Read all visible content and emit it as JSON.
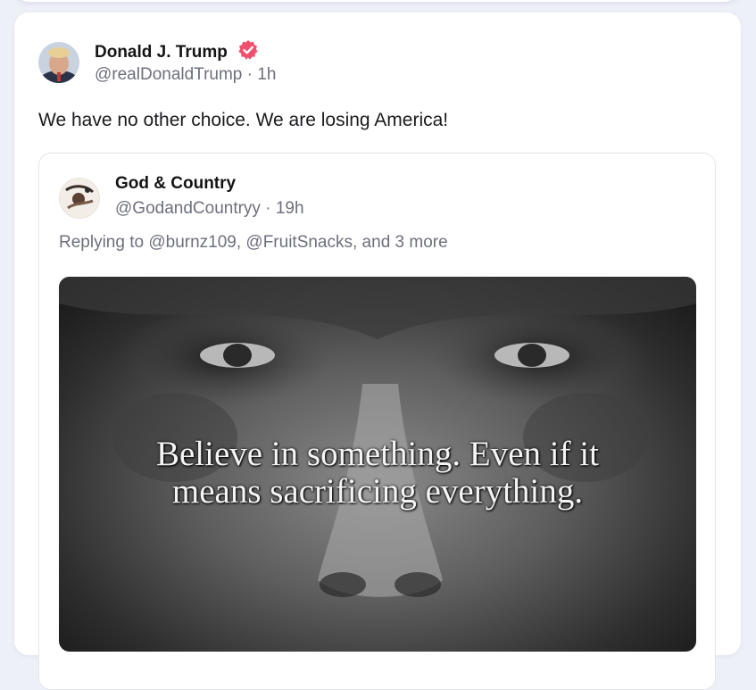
{
  "post": {
    "author_name": "Donald J. Trump",
    "author_handle": "@realDonaldTrump",
    "separator": "·",
    "time": "1h",
    "verified_icon": "verified-badge-icon",
    "text": "We have no other choice. We are losing America!"
  },
  "quoted": {
    "author_name": "God & Country",
    "author_handle": "@GodandCountryy",
    "separator": "·",
    "time": "19h",
    "reply_line": "Replying to @burnz109, @FruitSnacks, and 3 more",
    "image_caption_line1": "Believe in something. Even if it",
    "image_caption_line2": "means sacrificing everything."
  },
  "colors": {
    "verified": "#f0506e",
    "muted_text": "#6d6f7c",
    "background": "#eef0f8"
  }
}
